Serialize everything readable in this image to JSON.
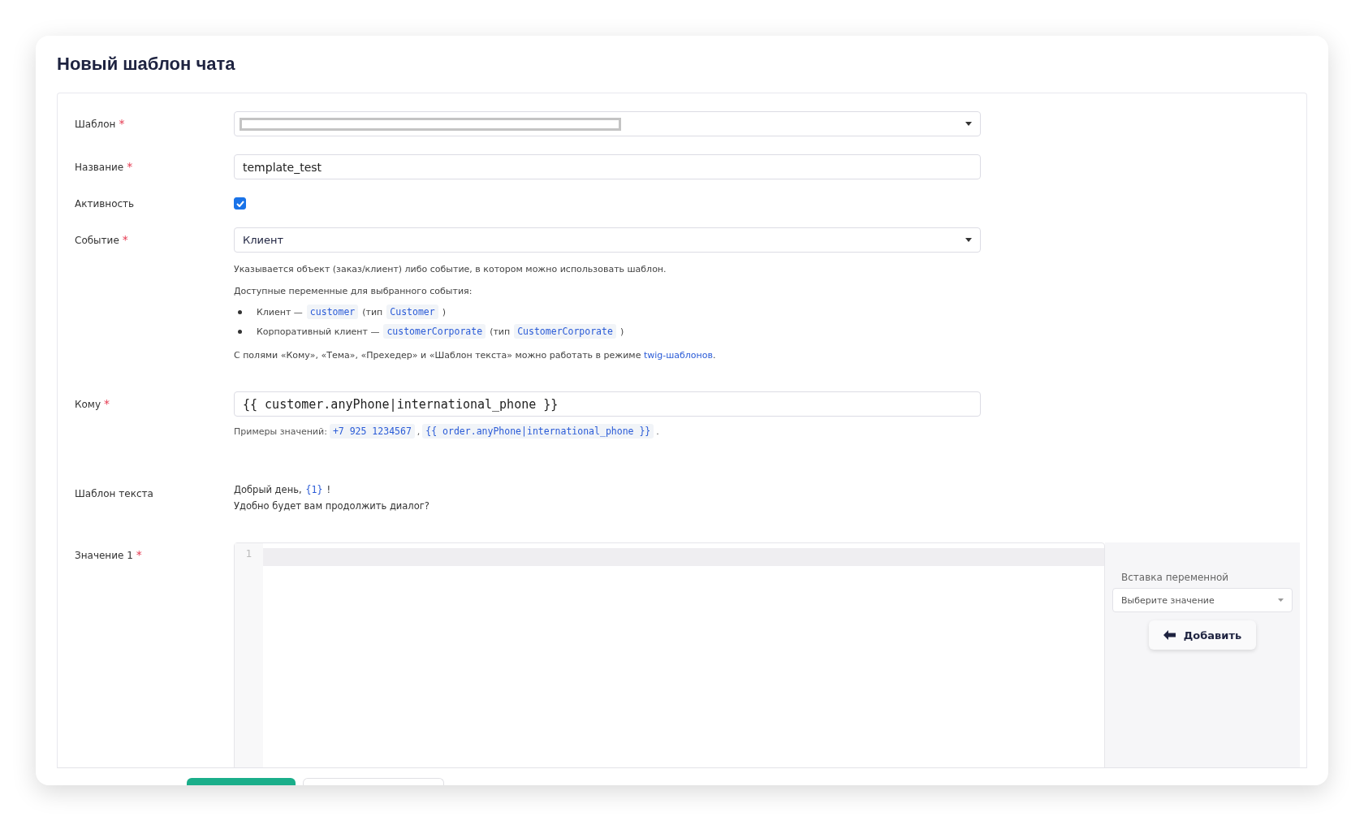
{
  "title": "Новый шаблон чата",
  "required_mark": "*",
  "template_field": {
    "label": "Шаблон",
    "required": true
  },
  "name_field": {
    "label": "Название",
    "required": true,
    "value": "template_test"
  },
  "active_field": {
    "label": "Активность",
    "checked": true
  },
  "event_field": {
    "label": "Событие",
    "required": true,
    "value": "Клиент",
    "hint": "Указывается объект (заказ/клиент) либо событие, в котором можно использовать шаблон.",
    "variables_heading": "Доступные переменные для выбранного события:",
    "variables": [
      {
        "name": "Клиент —",
        "code": "customer",
        "type_prefix": "(тип",
        "type": "Customer",
        "type_suffix": ")"
      },
      {
        "name": "Корпоративный клиент —",
        "code": "customerCorporate",
        "type_prefix": "(тип",
        "type": "CustomerCorporate",
        "type_suffix": ")"
      }
    ],
    "twig_note": "С полями «Кому», «Тема», «Прехедер» и «Шаблон текста» можно работать в режиме",
    "twig_link": "twig-шаблонов",
    "twig_end": "."
  },
  "to_field": {
    "label": "Кому",
    "required": true,
    "value": "{{ customer.anyPhone|international_phone }}",
    "examples_label": "Примеры значений:",
    "examples": [
      "+7 925 1234567",
      "{{ order.anyPhone|international_phone }}"
    ],
    "separator": ",",
    "examples_end": "."
  },
  "text_template": {
    "label": "Шаблон текста",
    "first_line": "Добрый  день,",
    "variable": "{1}",
    "first_end": "!",
    "second_line": "Удобно будет вам продолжить диалог?"
  },
  "value_1": {
    "label": "Значение 1",
    "required": true,
    "line_numbers": [
      "1"
    ]
  },
  "insert_panel": {
    "label": "Вставка переменной",
    "placeholder": "Выберите значение",
    "button": "Добавить"
  },
  "footer_buttons": [
    {
      "kind": "primary"
    },
    {
      "kind": "secondary"
    }
  ]
}
